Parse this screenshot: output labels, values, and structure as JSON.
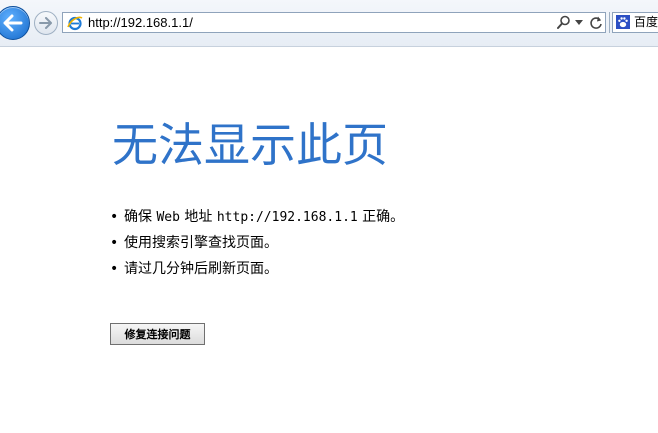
{
  "browser": {
    "address_bar": {
      "url": "http://192.168.1.1/"
    },
    "tab": {
      "label": "百度",
      "icon": "baidu-paw-icon"
    },
    "icons": {
      "back": "back-arrow-icon",
      "forward": "forward-arrow-icon",
      "page": "internet-explorer-icon",
      "search": "search-icon",
      "dropdown": "chevron-down-icon",
      "refresh": "refresh-icon"
    }
  },
  "error_page": {
    "title": "无法显示此页",
    "bullets": [
      {
        "dot": "•",
        "before": "确保 ",
        "web": "Web",
        "mid": " 地址 ",
        "url": "http://192.168.1.1",
        "after": " 正确。"
      },
      {
        "dot": "•",
        "text": "使用搜索引擎查找页面。"
      },
      {
        "dot": "•",
        "text": "请过几分钟后刷新页面。"
      }
    ],
    "fix_button_label": "修复连接问题"
  },
  "colors": {
    "title": "#2f73c9",
    "back_button": "#1468c9"
  }
}
